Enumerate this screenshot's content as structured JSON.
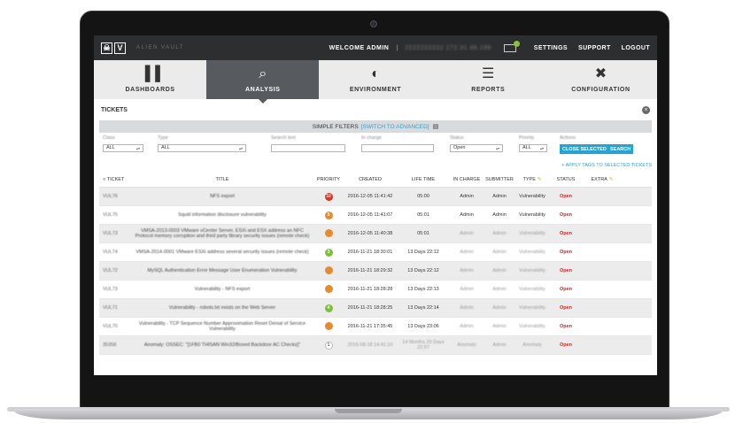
{
  "app": {
    "logo_letters": [
      "☠",
      "V"
    ],
    "logo_text": "ALIEN VAULT",
    "welcome": "WELCOME ADMIN",
    "separator": "|",
    "user_host": "2222222222 172.31.46.199",
    "top_links": [
      "SETTINGS",
      "SUPPORT",
      "LOGOUT"
    ]
  },
  "nav": [
    {
      "label": "DASHBOARDS",
      "icon": "bar-chart-icon",
      "glyph": "▐▐",
      "active": false
    },
    {
      "label": "ANALYSIS",
      "icon": "magnifier-icon",
      "glyph": "⌕",
      "active": true
    },
    {
      "label": "ENVIRONMENT",
      "icon": "planet-icon",
      "glyph": "◐",
      "active": false
    },
    {
      "label": "REPORTS",
      "icon": "report-icon",
      "glyph": "☰",
      "active": false
    },
    {
      "label": "CONFIGURATION",
      "icon": "tools-icon",
      "glyph": "✖",
      "active": false
    }
  ],
  "section": {
    "title": "TICKETS",
    "close": "×"
  },
  "filters": {
    "simple_label": "SIMPLE FILTERS",
    "advanced_link": "[SWITCH TO ADVANCED]",
    "class_label": "Class",
    "class_value": "ALL",
    "type_label": "Type",
    "type_value": "ALL",
    "search_label": "Search text",
    "search_value": "",
    "incharge_label": "In charge",
    "incharge_value": "",
    "status_label": "Status",
    "status_value": "Open",
    "priority_label": "Priority",
    "priority_value": "ALL",
    "actions_label": "Actions",
    "close_selected": "CLOSE SELECTED",
    "search_button": "SEARCH",
    "apply_tags": "+ APPLY TAGS TO SELECTED TICKETS"
  },
  "table": {
    "headers": {
      "ticket": "TICKET",
      "title": "TITLE",
      "priority": "PRIORITY",
      "created": "CREATED",
      "life": "LIFE TIME",
      "charge": "IN CHARGE",
      "submitter": "SUBMITTER",
      "type": "TYPE",
      "status": "STATUS",
      "extra": "EXTRA"
    },
    "rows": [
      {
        "id": "VUL76",
        "title": "NFS export",
        "priority": "10",
        "priority_color": "#e0301e",
        "created": "2016-12-05 11:41:42",
        "life": "05:00",
        "charge": "Admin",
        "submitter": "Admin",
        "type": "Vulnerability",
        "status": "Open"
      },
      {
        "id": "VUL75",
        "title": "Squid information disclosure vulnerability",
        "priority": "5",
        "priority_color": "#e8892a",
        "created": "2016-12-05 11:41:07",
        "life": "05:01",
        "charge": "Admin",
        "submitter": "Admin",
        "type": "Vulnerability",
        "status": "Open"
      },
      {
        "id": "VUL73",
        "title": "VMSA-2013-0003 VMware vCenter Server, ESXi and ESX address an NFC Protocol memory corruption and third party library security issues (remote check)",
        "priority": "",
        "priority_color": "#e8892a",
        "created": "2016-12-05 11:40:38",
        "life": "05:01",
        "charge": "Admin",
        "submitter": "Admin",
        "type": "Vulnerability",
        "status": "Open"
      },
      {
        "id": "VUL74",
        "title": "VMSA-2014-0001 VMware ESXi address several security issues (remote check)",
        "priority": "3",
        "priority_color": "#7cbf3b",
        "created": "2016-11-21 18:30:01",
        "life": "13 Days 22:12",
        "charge": "Admin",
        "submitter": "Admin",
        "type": "Vulnerability",
        "status": "Open"
      },
      {
        "id": "VUL72",
        "title": "MySQL Authentication Error Message User Enumeration Vulnerability",
        "priority": "",
        "priority_color": "#e8892a",
        "created": "2016-11-21 18:29:32",
        "life": "13 Days 22:12",
        "charge": "Admin",
        "submitter": "Admin",
        "type": "Vulnerability",
        "status": "Open"
      },
      {
        "id": "VUL73",
        "title": "Vulnerability - NFS export",
        "priority": "",
        "priority_color": "#e8892a",
        "created": "2016-11-21 18:28:28",
        "life": "13 Days 22:13",
        "charge": "Admin",
        "submitter": "Admin",
        "type": "Vulnerability",
        "status": "Open"
      },
      {
        "id": "VUL71",
        "title": "Vulnerability - robots.txt exists on the Web Server",
        "priority": "4",
        "priority_color": "#7cbf3b",
        "created": "2016-11-21 18:28:25",
        "life": "13 Days 22:14",
        "charge": "Admin",
        "submitter": "Admin",
        "type": "Vulnerability",
        "status": "Open"
      },
      {
        "id": "VUL70",
        "title": "Vulnerability - TCP Sequence Number Approximation Reset Denial of Service Vulnerability",
        "priority": "",
        "priority_color": "#e8892a",
        "created": "2016-11-21 17:35:45",
        "life": "13 Days 23:06",
        "charge": "Admin",
        "submitter": "Admin",
        "type": "Vulnerability",
        "status": "Open"
      },
      {
        "id": "35358",
        "title": "Anomaly: OSSEC: \"[1FB0 THISAN Win32/Boxed Backdoor AC Checks]\"",
        "priority": "1",
        "priority_color": "#ffffff",
        "created": "2016-08-18 14:41:10",
        "life": "14 Months 20 Days 22:07",
        "charge": "Anomaly",
        "submitter": "Admin",
        "type": "Anomaly",
        "status": "Open"
      }
    ]
  }
}
